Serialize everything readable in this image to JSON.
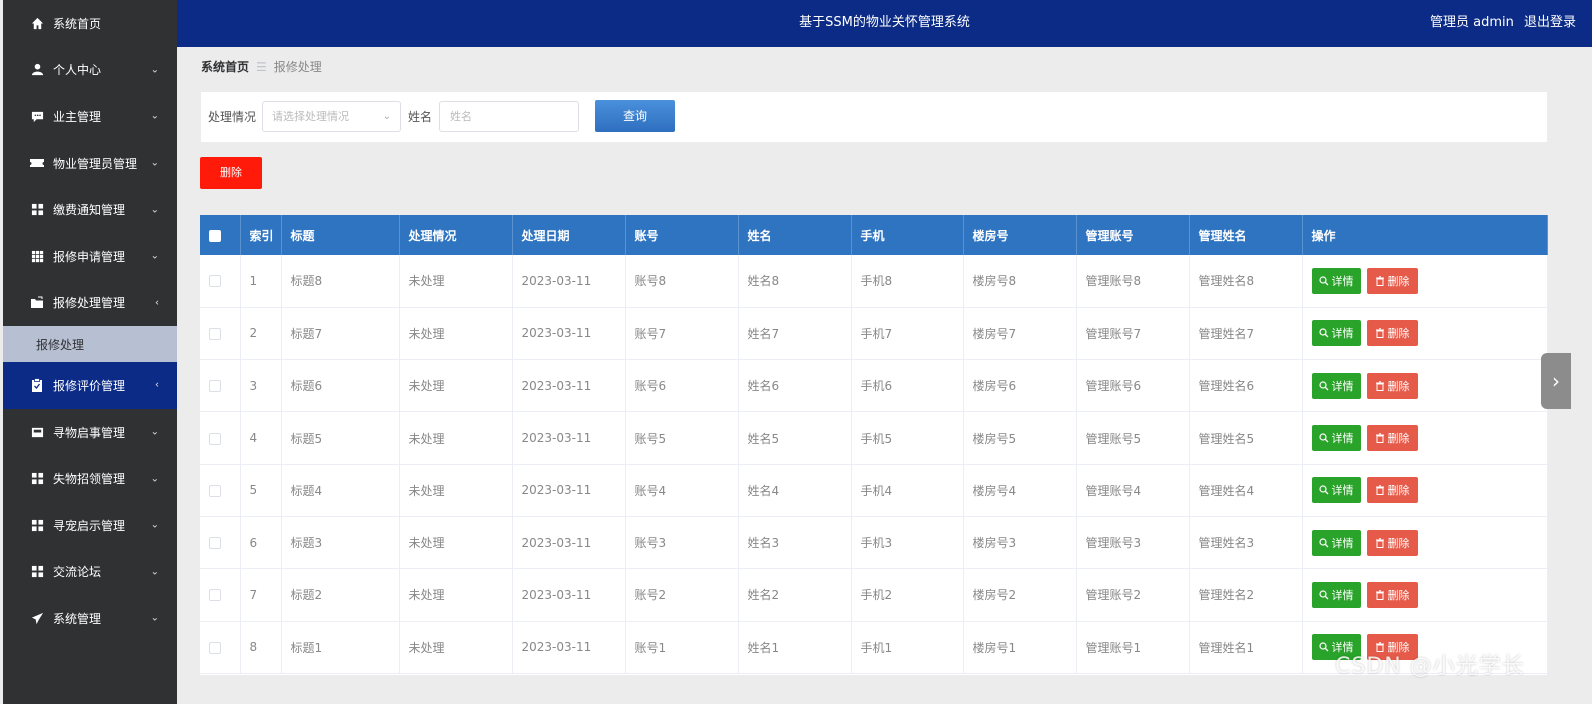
{
  "sidebar": {
    "items": [
      {
        "label": "系统首页",
        "icon": "home-icon",
        "chevron": ""
      },
      {
        "label": "个人中心",
        "icon": "user-icon",
        "chevron": "⌄"
      },
      {
        "label": "业主管理",
        "icon": "chat-icon",
        "chevron": "⌄"
      },
      {
        "label": "物业管理员管理",
        "icon": "ticket-icon",
        "chevron": "⌄"
      },
      {
        "label": "缴费通知管理",
        "icon": "grid-icon",
        "chevron": "⌄"
      },
      {
        "label": "报修申请管理",
        "icon": "table-grid-icon",
        "chevron": "⌄"
      },
      {
        "label": "报修处理管理",
        "icon": "folder-icon",
        "chevron": "‹"
      }
    ],
    "sub_item": "报修处理",
    "items2": [
      {
        "label": "报修评价管理",
        "icon": "clipboard-icon",
        "chevron": "‹"
      },
      {
        "label": "寻物启事管理",
        "icon": "inbox-icon",
        "chevron": "⌄"
      },
      {
        "label": "失物招领管理",
        "icon": "grid-icon",
        "chevron": "⌄"
      },
      {
        "label": "寻宠启示管理",
        "icon": "grid-icon",
        "chevron": "⌄"
      },
      {
        "label": "交流论坛",
        "icon": "grid-icon",
        "chevron": "⌄"
      },
      {
        "label": "系统管理",
        "icon": "send-icon",
        "chevron": "⌄"
      }
    ]
  },
  "header": {
    "title": "基于SSM的物业关怀管理系统",
    "user": "管理员 admin",
    "logout": "退出登录"
  },
  "breadcrumb": {
    "home": "系统首页",
    "sep": "☰",
    "current": "报修处理"
  },
  "search": {
    "status_label": "处理情况",
    "status_placeholder": "请选择处理情况",
    "name_label": "姓名",
    "name_placeholder": "姓名",
    "query_button": "查询"
  },
  "delete_button": "删除",
  "table": {
    "columns": [
      "索引",
      "标题",
      "处理情况",
      "处理日期",
      "账号",
      "姓名",
      "手机",
      "楼房号",
      "管理账号",
      "管理姓名",
      "操作"
    ],
    "detail_label": "详情",
    "delete_label": "删除",
    "rows": [
      [
        "1",
        "标题8",
        "未处理",
        "2023-03-11",
        "账号8",
        "姓名8",
        "手机8",
        "楼房号8",
        "管理账号8",
        "管理姓名8"
      ],
      [
        "2",
        "标题7",
        "未处理",
        "2023-03-11",
        "账号7",
        "姓名7",
        "手机7",
        "楼房号7",
        "管理账号7",
        "管理姓名7"
      ],
      [
        "3",
        "标题6",
        "未处理",
        "2023-03-11",
        "账号6",
        "姓名6",
        "手机6",
        "楼房号6",
        "管理账号6",
        "管理姓名6"
      ],
      [
        "4",
        "标题5",
        "未处理",
        "2023-03-11",
        "账号5",
        "姓名5",
        "手机5",
        "楼房号5",
        "管理账号5",
        "管理姓名5"
      ],
      [
        "5",
        "标题4",
        "未处理",
        "2023-03-11",
        "账号4",
        "姓名4",
        "手机4",
        "楼房号4",
        "管理账号4",
        "管理姓名4"
      ],
      [
        "6",
        "标题3",
        "未处理",
        "2023-03-11",
        "账号3",
        "姓名3",
        "手机3",
        "楼房号3",
        "管理账号3",
        "管理姓名3"
      ],
      [
        "7",
        "标题2",
        "未处理",
        "2023-03-11",
        "账号2",
        "姓名2",
        "手机2",
        "楼房号2",
        "管理账号2",
        "管理姓名2"
      ],
      [
        "8",
        "标题1",
        "未处理",
        "2023-03-11",
        "账号1",
        "姓名1",
        "手机1",
        "楼房号1",
        "管理账号1",
        "管理姓名1"
      ]
    ]
  },
  "watermark": "CSDN @小光学长"
}
